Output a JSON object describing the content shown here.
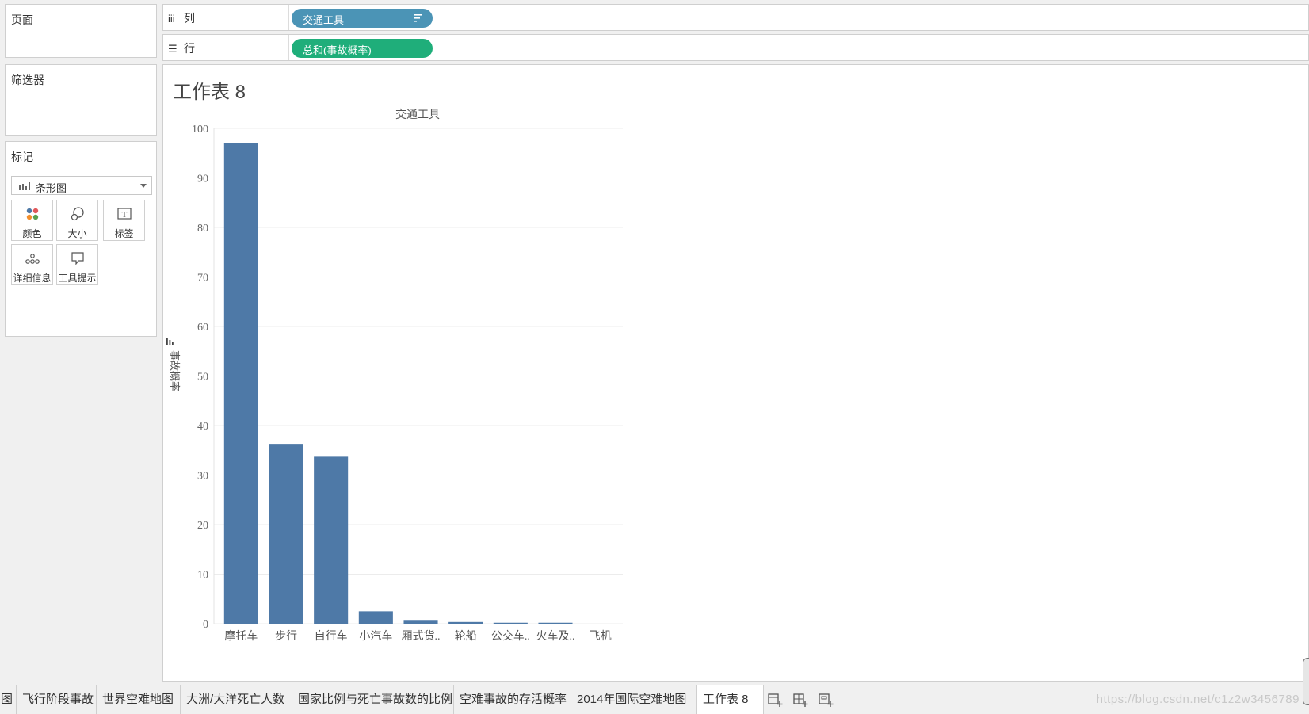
{
  "left_panel": {
    "pages_title": "页面",
    "filters_title": "筛选器",
    "marks_title": "标记",
    "mark_type": "条形图",
    "mark_buttons": [
      {
        "label": "颜色",
        "icon": "color-dots-icon"
      },
      {
        "label": "大小",
        "icon": "size-icon"
      },
      {
        "label": "标签",
        "icon": "label-text-icon"
      },
      {
        "label": "详细信息",
        "icon": "detail-dots-icon"
      },
      {
        "label": "工具提示",
        "icon": "tooltip-icon"
      }
    ]
  },
  "shelves": {
    "columns": {
      "symbol": "iii",
      "label": "列",
      "pill": "交通工具",
      "pill_color": "#4b94b6"
    },
    "rows": {
      "symbol": "☰",
      "label": "行",
      "pill": "总和(事故概率)",
      "pill_color": "#1fae7a"
    }
  },
  "worksheet": {
    "title": "工作表 8"
  },
  "chart_data": {
    "type": "bar",
    "title": "交通工具",
    "ylabel": "事故概率",
    "xlabel": "",
    "categories": [
      "摩托车",
      "步行",
      "自行车",
      "小汽车",
      "厢式货..",
      "轮船",
      "公交车..",
      "火车及..",
      "飞机"
    ],
    "values": [
      97,
      36.3,
      33.7,
      2.5,
      0.6,
      0.35,
      0.2,
      0.2,
      0
    ],
    "ylim": [
      0,
      100
    ],
    "yticks": [
      0,
      10,
      20,
      30,
      40,
      50,
      60,
      70,
      80,
      90,
      100
    ],
    "bar_color": "#4e79a7",
    "grid": true
  },
  "tabs": [
    {
      "label": "图",
      "active": false
    },
    {
      "label": "飞行阶段事故",
      "active": false
    },
    {
      "label": "世界空难地图",
      "active": false
    },
    {
      "label": "大洲/大洋死亡人数",
      "active": false
    },
    {
      "label": "国家比例与死亡事故数的比例",
      "active": false
    },
    {
      "label": "空难事故的存活概率",
      "active": false
    },
    {
      "label": "2014年国际空难地图",
      "active": false
    },
    {
      "label": "工作表 8",
      "active": true
    }
  ],
  "tab_tools": [
    "new-worksheet-icon",
    "new-dashboard-icon",
    "new-story-icon"
  ],
  "watermark": "https://blog.csdn.net/c1z2w3456789"
}
